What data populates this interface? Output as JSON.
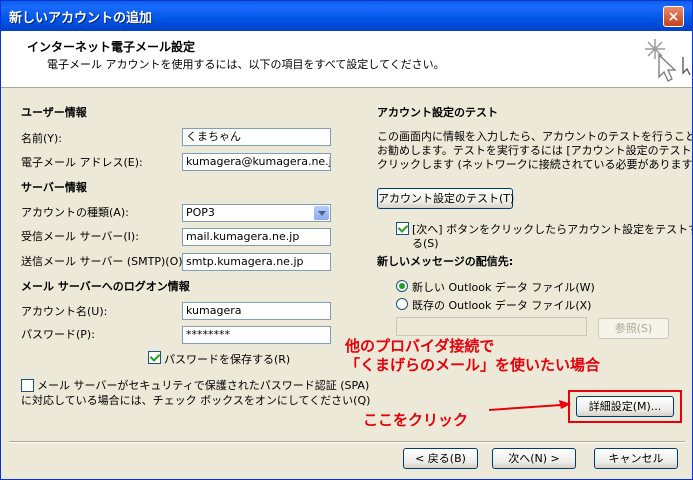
{
  "window": {
    "title": "新しいアカウントの追加",
    "close_label": "×"
  },
  "header": {
    "title": "インターネット電子メール設定",
    "subtitle": "電子メール アカウントを使用するには、以下の項目をすべて設定してください。"
  },
  "user_info": {
    "heading": "ユーザー情報",
    "name_label": "名前(Y):",
    "name_value": "くまちゃん",
    "email_label": "電子メール アドレス(E):",
    "email_value": "kumagera@kumagera.ne.jp"
  },
  "server_info": {
    "heading": "サーバー情報",
    "account_type_label": "アカウントの種類(A):",
    "account_type_value": "POP3",
    "incoming_label": "受信メール サーバー(I):",
    "incoming_value": "mail.kumagera.ne.jp",
    "outgoing_label": "送信メール サーバー (SMTP)(O):",
    "outgoing_value": "smtp.kumagera.ne.jp"
  },
  "logon_info": {
    "heading": "メール サーバーへのログオン情報",
    "account_name_label": "アカウント名(U):",
    "account_name_value": "kumagera",
    "password_label": "パスワード(P):",
    "password_value": "********",
    "save_password_label": "パスワードを保存する(R)",
    "spa_line1": "メール サーバーがセキュリティで保護されたパスワード認証 (SPA)",
    "spa_line2": "に対応している場合には、チェック ボックスをオンにしてください(Q)"
  },
  "test": {
    "heading": "アカウント設定のテスト",
    "desc_line1": "この画面内に情報を入力したら、アカウントのテストを行うことを",
    "desc_line2": "お勧めします。テストを実行するには [アカウント設定のテスト] を",
    "desc_line3": "クリックします (ネットワークに接続されている必要があります)。",
    "test_button": "アカウント設定のテスト(T)",
    "auto_test_line1": "[次へ] ボタンをクリックしたらアカウント設定をテストす",
    "auto_test_line2": "る(S)"
  },
  "delivery": {
    "heading": "新しいメッセージの配信先:",
    "new_file_label": "新しい Outlook データ ファイル(W)",
    "existing_file_label": "既存の Outlook データ ファイル(X)",
    "path_value": "",
    "browse_button": "参照(S)"
  },
  "annotation": {
    "line1": "他のプロバイダ接続で",
    "line2": "「くまげらのメール」を使いたい場合",
    "click_here": "ここをクリック"
  },
  "buttons": {
    "more_settings": "詳細設定(M)...",
    "back": "< 戻る(B)",
    "next": "次へ(N) >",
    "cancel": "キャンセル"
  },
  "colors": {
    "annotation_red": "#e8000b",
    "titlebar_blue": "#0055e5"
  }
}
